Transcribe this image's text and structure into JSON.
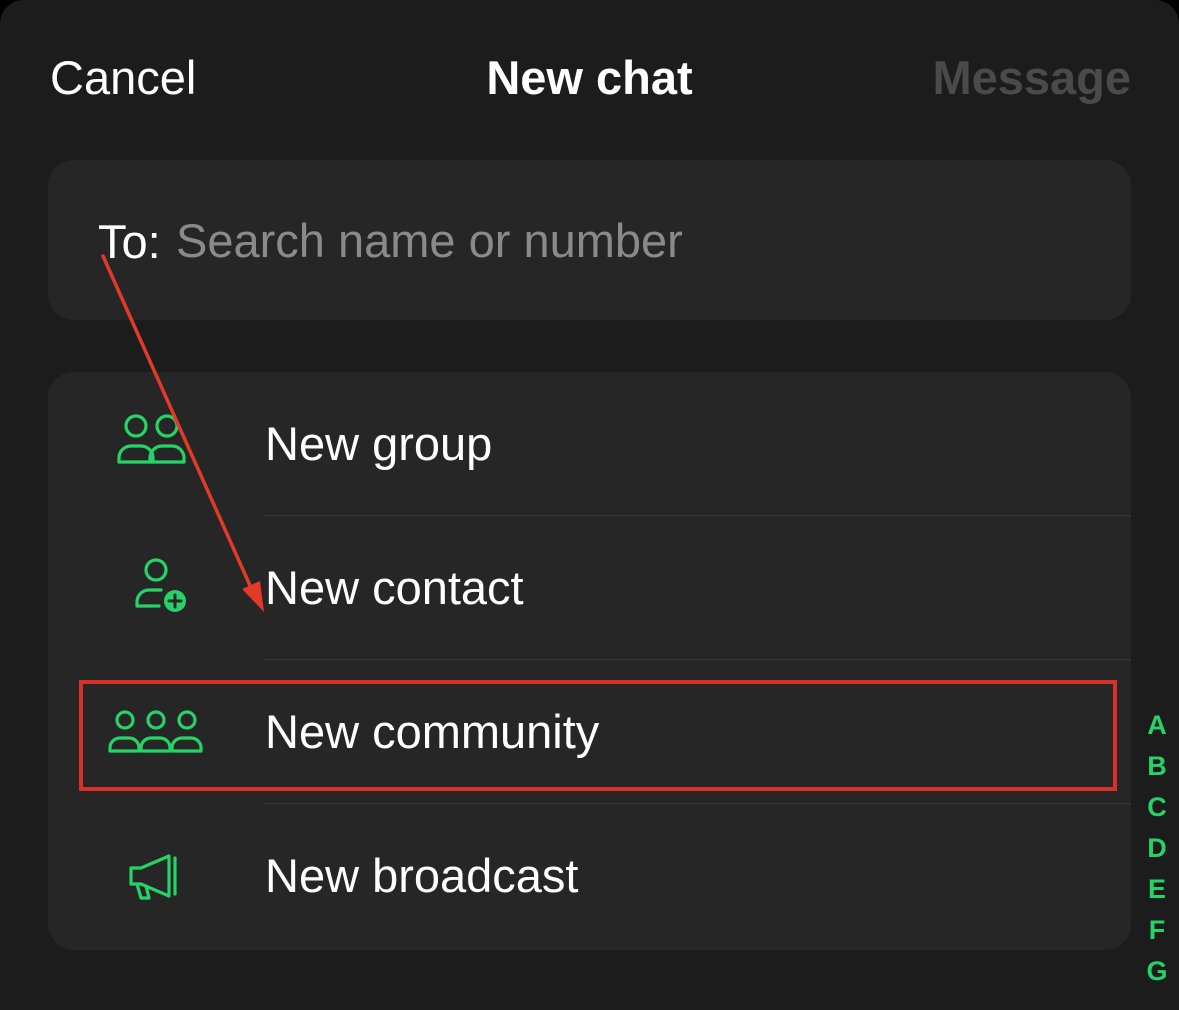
{
  "header": {
    "cancel_label": "Cancel",
    "title": "New chat",
    "message_label": "Message"
  },
  "search": {
    "label": "To:",
    "placeholder": "Search name or number",
    "value": ""
  },
  "menu": {
    "items": [
      {
        "label": "New group",
        "icon": "group-icon"
      },
      {
        "label": "New contact",
        "icon": "add-contact-icon"
      },
      {
        "label": "New community",
        "icon": "community-icon"
      },
      {
        "label": "New broadcast",
        "icon": "broadcast-icon"
      }
    ]
  },
  "index": [
    "A",
    "B",
    "C",
    "D",
    "E",
    "F",
    "G"
  ],
  "colors": {
    "accent": "#25d366",
    "background": "#1c1c1c",
    "card": "#262626",
    "annotation": "#d93025"
  }
}
